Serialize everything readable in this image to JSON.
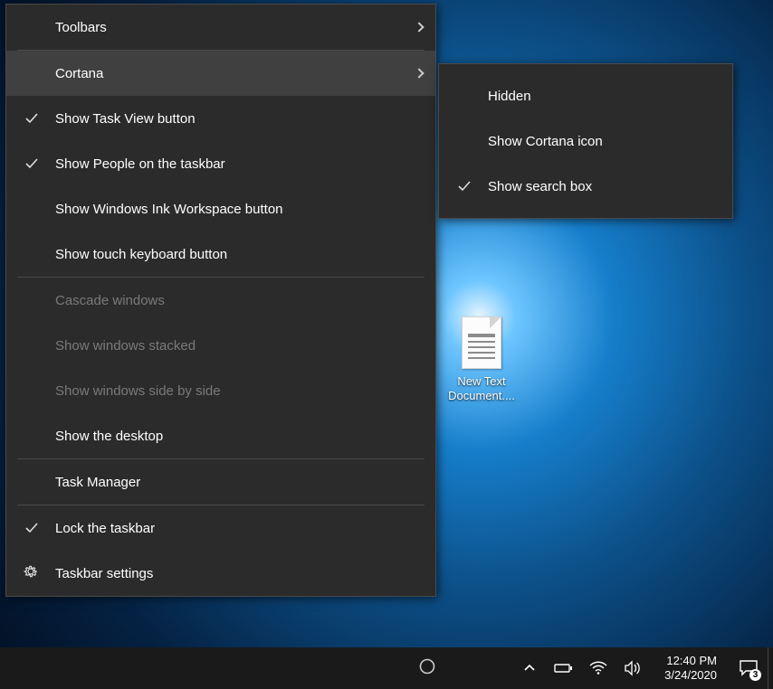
{
  "desktop": {
    "icon_label": "New Text Document...."
  },
  "context_menu": {
    "toolbars": "Toolbars",
    "cortana": "Cortana",
    "show_task_view": "Show Task View button",
    "show_people": "Show People on the taskbar",
    "show_ink": "Show Windows Ink Workspace button",
    "show_touch_kb": "Show touch keyboard button",
    "cascade": "Cascade windows",
    "stacked": "Show windows stacked",
    "side_by_side": "Show windows side by side",
    "show_desktop": "Show the desktop",
    "task_manager": "Task Manager",
    "lock_taskbar": "Lock the taskbar",
    "taskbar_settings": "Taskbar settings"
  },
  "cortana_submenu": {
    "hidden": "Hidden",
    "show_icon": "Show Cortana icon",
    "show_search": "Show search box"
  },
  "systray": {
    "time": "12:40 PM",
    "date": "3/24/2020",
    "notification_count": "3"
  }
}
